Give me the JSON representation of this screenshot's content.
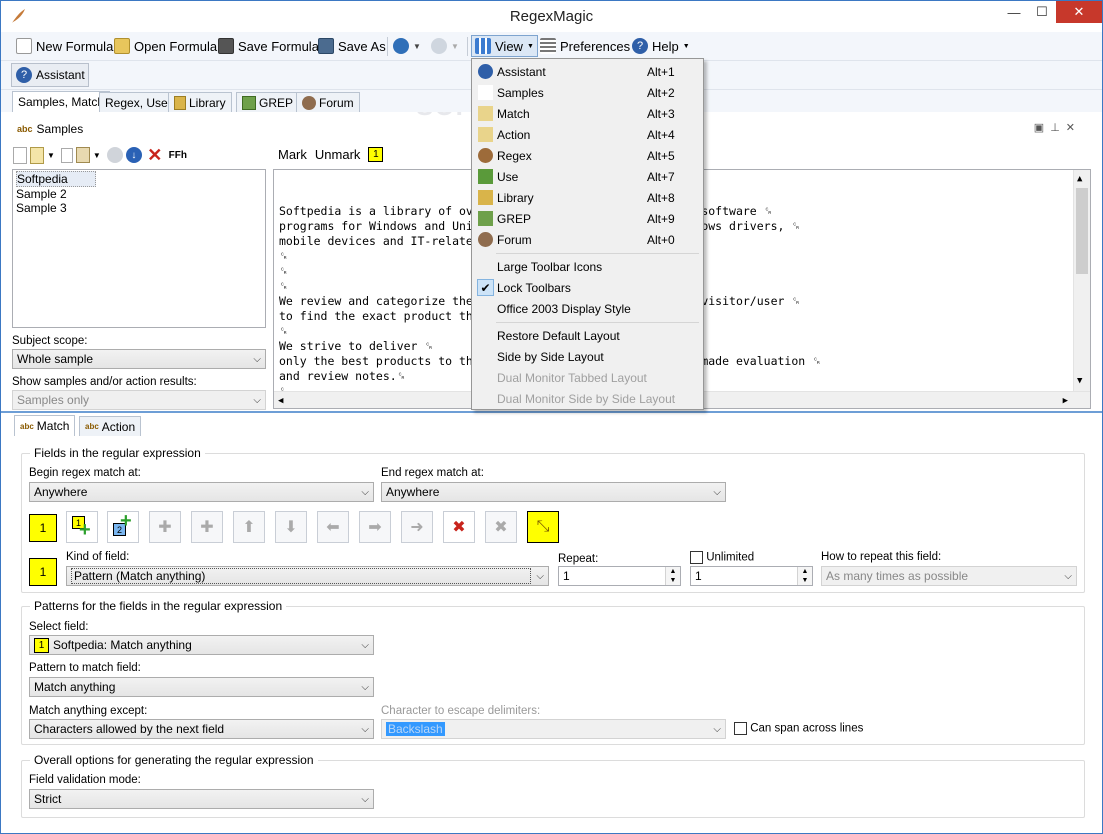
{
  "window": {
    "title": "RegexMagic",
    "minimize": "—",
    "maximize": "☐",
    "close": "✕"
  },
  "toolbar": {
    "new_formula": "New Formula",
    "open_formula": "Open Formula",
    "save_formula": "Save Formula",
    "save_as": "Save As",
    "view": "View",
    "preferences": "Preferences",
    "help": "Help"
  },
  "toolbar2": {
    "assistant": "Assistant"
  },
  "tabs": [
    "Samples, Match",
    "Regex, Use",
    "Library",
    "GREP",
    "Forum"
  ],
  "samples_panel": {
    "title": "Samples",
    "items": [
      "Softpedia",
      "Sample 2",
      "Sample 3"
    ],
    "mark": "Mark",
    "unmark": "Unmark",
    "mark_num": "1",
    "ffh": "FFh",
    "subject_scope_label": "Subject scope:",
    "subject_scope_value": "Whole sample",
    "show_label": "Show samples and/or action results:",
    "show_value": "Samples only"
  },
  "editor": {
    "lines": [
      "Softpedia is a library of ov                               y software ␍",
      "programs for Windows and Uni                               ndows drivers, ␍",
      "mobile devices and IT-relate",
      "␍",
      "␍",
      "␍",
      "We review and categorize the                               e visitor/user ␍",
      "to find the exact product th",
      "␍",
      "We strive to deliver ␍",
      "only the best products to th                               f-made evaluation ␍",
      "and review notes.␍",
      "␍",
      "␍"
    ]
  },
  "bottom_tabs": [
    "Match",
    "Action"
  ],
  "fields_group": {
    "title": "Fields in the regular expression",
    "begin_label": "Begin regex match at:",
    "begin_value": "Anywhere",
    "end_label": "End regex match at:",
    "end_value": "Anywhere",
    "field_num": "1",
    "add1": "1",
    "add2": "2",
    "kind_label": "Kind of field:",
    "kind_value": "Pattern (Match anything)",
    "repeat_label": "Repeat:",
    "repeat_value": "1",
    "unlimited_label": "Unlimited",
    "unlimited_value": "1",
    "how_label": "How to repeat this field:",
    "how_value": "As many times as possible"
  },
  "patterns_group": {
    "title": "Patterns for the fields in the regular expression",
    "select_label": "Select field:",
    "select_num": "1",
    "select_value": "Softpedia: Match anything",
    "pattern_label": "Pattern to match field:",
    "pattern_value": "Match anything",
    "except_label": "Match anything except:",
    "except_value": "Characters allowed by the next field",
    "escape_label": "Character to escape delimiters:",
    "escape_value": "Backslash",
    "span_label": "Can span across lines"
  },
  "overall_group": {
    "title": "Overall options for generating the regular expression",
    "validation_label": "Field validation mode:",
    "validation_value": "Strict"
  },
  "view_menu": {
    "items": [
      {
        "label": "Assistant",
        "shortcut": "Alt+1",
        "icon": "assistant-icon"
      },
      {
        "label": "Samples",
        "shortcut": "Alt+2",
        "icon": "samples-icon"
      },
      {
        "label": "Match",
        "shortcut": "Alt+3",
        "icon": "match-icon"
      },
      {
        "label": "Action",
        "shortcut": "Alt+4",
        "icon": "action-icon"
      },
      {
        "label": "Regex",
        "shortcut": "Alt+5",
        "icon": "regex-icon"
      },
      {
        "label": "Use",
        "shortcut": "Alt+7",
        "icon": "use-icon"
      },
      {
        "label": "Library",
        "shortcut": "Alt+8",
        "icon": "library-icon"
      },
      {
        "label": "GREP",
        "shortcut": "Alt+9",
        "icon": "grep-icon"
      },
      {
        "label": "Forum",
        "shortcut": "Alt+0",
        "icon": "forum-icon"
      }
    ],
    "options": [
      "Large Toolbar Icons",
      "Lock Toolbars",
      "Office 2003 Display Style"
    ],
    "layouts": [
      "Restore Default Layout",
      "Side by Side Layout",
      "Dual Monitor Tabbed Layout",
      "Dual Monitor Side by Side Layout"
    ]
  },
  "watermark": "SOFTPEDIA"
}
